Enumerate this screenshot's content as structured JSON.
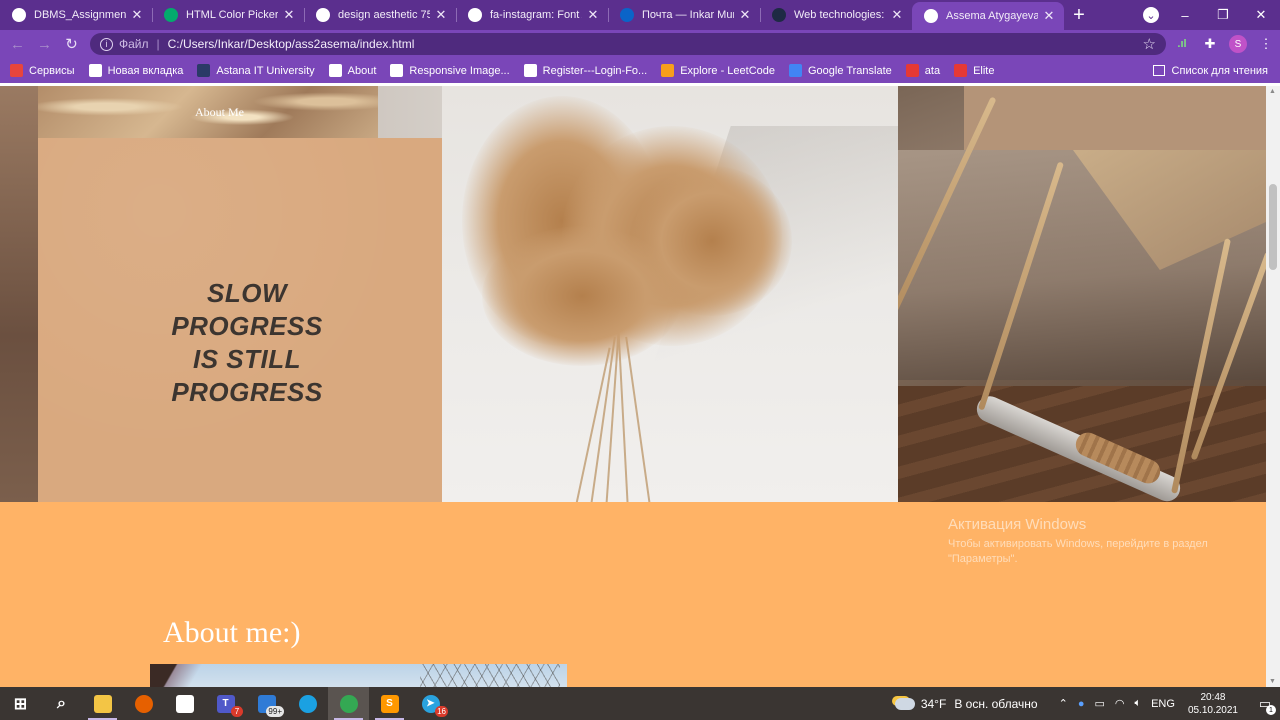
{
  "browser": {
    "tabs": [
      {
        "title": "DBMS_Assignment_4_",
        "icon": "globe-icon",
        "icon_color": "#ffffff",
        "active": false
      },
      {
        "title": "HTML Color Picker",
        "icon": "w3schools-icon",
        "icon_color": "#04aa6d",
        "active": false
      },
      {
        "title": "design aesthetic 750x",
        "icon": "google-icon",
        "icon_color": "#ffffff",
        "active": false
      },
      {
        "title": "fa-instagram: Font Aw",
        "icon": "flag-icon",
        "icon_color": "#ffffff",
        "active": false
      },
      {
        "title": "Почта — Inkar Munb",
        "icon": "outlook-icon",
        "icon_color": "#0a64c8",
        "active": false
      },
      {
        "title": "Web technologies: As",
        "icon": "moodle-icon",
        "icon_color": "#1e2a44",
        "active": false
      },
      {
        "title": "Assema Atygayeva",
        "icon": "globe-icon",
        "icon_color": "#ffffff",
        "active": true
      }
    ],
    "new_tab": "+",
    "window_controls": {
      "minimize": "–",
      "maximize": "❐",
      "close": "✕",
      "menu": "⌄"
    },
    "address_bar": {
      "scheme_label": "Файл",
      "separator": "|",
      "url": "C:/Users/Inkar/Desktop/ass2asema/index.html"
    },
    "profile_initial": "S",
    "bookmarks": [
      {
        "label": "Сервисы",
        "icon": "apps-grid-icon",
        "color": "#e8453c"
      },
      {
        "label": "Новая вкладка",
        "icon": "globe-icon",
        "color": "#ffffff"
      },
      {
        "label": "Astana IT University",
        "icon": "aitu-icon",
        "color": "#2b3a67"
      },
      {
        "label": "About",
        "icon": "globe-icon",
        "color": "#ffffff"
      },
      {
        "label": "Responsive Image...",
        "icon": "history-icon",
        "color": "#ffffff"
      },
      {
        "label": "Register---Login-Fo...",
        "icon": "github-icon",
        "color": "#ffffff"
      },
      {
        "label": "Explore - LeetCode",
        "icon": "leetcode-icon",
        "color": "#f89f1b"
      },
      {
        "label": "Google Translate",
        "icon": "translate-icon",
        "color": "#4285f4"
      },
      {
        "label": "ata",
        "icon": "r-icon",
        "color": "#e53935"
      },
      {
        "label": "Elite",
        "icon": "lf-icon",
        "color": "#e53935"
      }
    ],
    "reading_list": "Список для чтения"
  },
  "page": {
    "nav_about": "About Me",
    "quote_lines": [
      "SLOW",
      "PROGRESS",
      "IS STILL",
      "PROGRESS"
    ],
    "about_heading": "About me:)",
    "accent_color": "#ffb366",
    "card_color": "#d9a97f"
  },
  "watermark": {
    "title": "Активация Windows",
    "subtitle": "Чтобы активировать Windows, перейдите в раздел \"Параметры\"."
  },
  "taskbar": {
    "apps": [
      {
        "name": "start-button",
        "glyph": "⊞",
        "color": "#ffffff"
      },
      {
        "name": "search-icon",
        "glyph": "⌕",
        "color": "#ffffff"
      },
      {
        "name": "file-explorer-icon",
        "glyph": "",
        "color": "#f3c545",
        "open": true
      },
      {
        "name": "firefox-icon",
        "glyph": "",
        "color": "#e66000"
      },
      {
        "name": "store-icon",
        "glyph": "",
        "color": "#ffffff"
      },
      {
        "name": "teams-icon",
        "glyph": "T",
        "color": "#5059c9",
        "badge": "7"
      },
      {
        "name": "mail-icon",
        "glyph": "",
        "color": "#2f7bd6",
        "badge": "99+",
        "badge_style": "grey"
      },
      {
        "name": "edge-icon",
        "glyph": "",
        "color": "#1ba1e2"
      },
      {
        "name": "chrome-icon",
        "glyph": "",
        "color": "#34a853",
        "open": true,
        "current": true
      },
      {
        "name": "sublime-text-icon",
        "glyph": "S",
        "color": "#ff9800",
        "open": true
      },
      {
        "name": "telegram-icon",
        "glyph": "➤",
        "color": "#2aa3df",
        "badge": "16"
      }
    ],
    "weather": {
      "temp": "34°F",
      "desc": "В осн. облачно"
    },
    "language": "ENG",
    "time": "20:48",
    "date": "05.10.2021",
    "notifications_count": "1"
  }
}
